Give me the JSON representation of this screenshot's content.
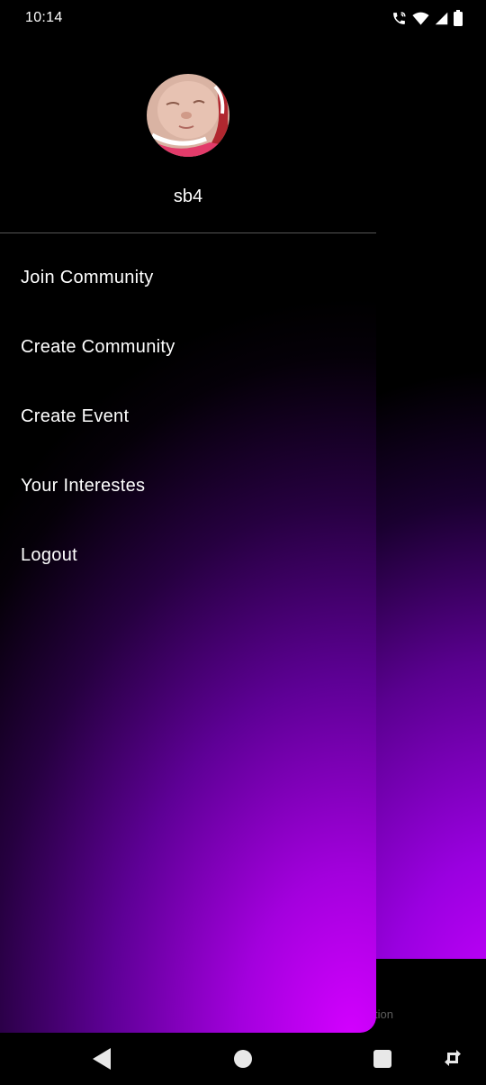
{
  "status_bar": {
    "time": "10:14",
    "icons": [
      "wifi-calling-icon",
      "wifi-icon",
      "signal-icon",
      "battery-icon"
    ]
  },
  "drawer": {
    "user": {
      "avatar_icon": "profile-photo",
      "name": "sb4"
    },
    "menu": [
      {
        "label": "Join Community"
      },
      {
        "label": "Create Community"
      },
      {
        "label": "Create Event"
      },
      {
        "label": "Your Interestes"
      },
      {
        "label": "Logout"
      }
    ]
  },
  "background_app": {
    "partial_nav_label": "tion"
  },
  "system_nav": {
    "buttons": [
      "back-icon",
      "home-icon",
      "recents-icon",
      "rotate-icon"
    ]
  },
  "colors": {
    "accent": "#c800ff",
    "background": "#000000"
  }
}
